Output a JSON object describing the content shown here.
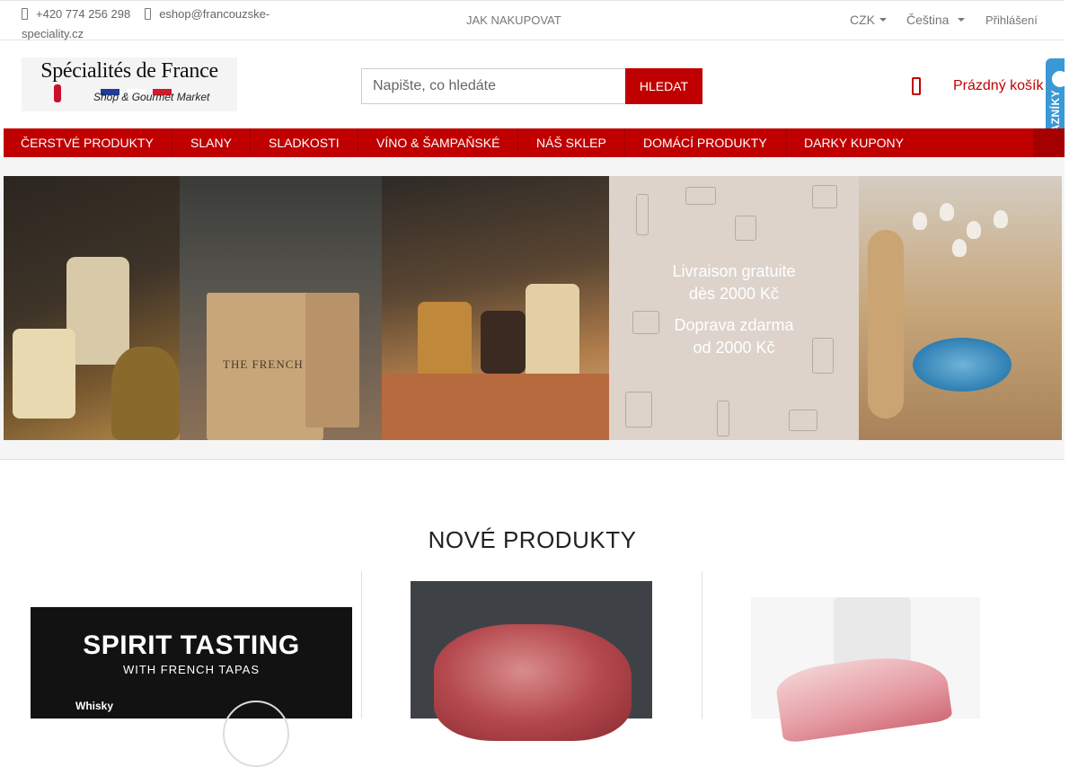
{
  "topbar": {
    "phone": "+420 774 256 298",
    "email": "eshop@francouzske-speciality.cz",
    "how_to_shop": "JAK NAKUPOVAT",
    "currency": "CZK",
    "language": "Čeština",
    "login": "Přihlášení"
  },
  "header": {
    "logo_title": "Spécialités de France",
    "logo_subtitle": "Shop & Gourmet Market",
    "search_placeholder": "Napište, co hledáte",
    "search_button": "HLEDAT",
    "cart_label": "Prázdný košík",
    "badge_text": "OVĚŘENO ZÁKAZNÍKY"
  },
  "nav": {
    "items": [
      {
        "label": "ČERSTVÉ PRODUKTY"
      },
      {
        "label": "SLANY"
      },
      {
        "label": "SLADKOSTI"
      },
      {
        "label": "VÍNO & ŠAMPAŇSKÉ"
      },
      {
        "label": "NÁŠ SKLEP"
      },
      {
        "label": "DOMÁCÍ PRODUKTY"
      },
      {
        "label": "DARKY KUPONY"
      }
    ]
  },
  "banner": {
    "bag_text": "THE FRENCH",
    "promo_line1": "Livraison gratuite",
    "promo_line2": "dès 2000 Kč",
    "promo_line3": "Doprava zdarma",
    "promo_line4": "od 2000 Kč"
  },
  "new_products": {
    "title": "NOVÉ PRODUKTY",
    "product1_title": "SPIRIT TASTING",
    "product1_subtitle": "WITH FRENCH TAPAS",
    "product1_detail": "Whisky"
  },
  "colors": {
    "brand_red": "#c00000",
    "badge_blue": "#3a98d5"
  },
  "icons": {
    "phone": "phone-icon",
    "email": "envelope-icon",
    "cart": "cart-icon"
  }
}
